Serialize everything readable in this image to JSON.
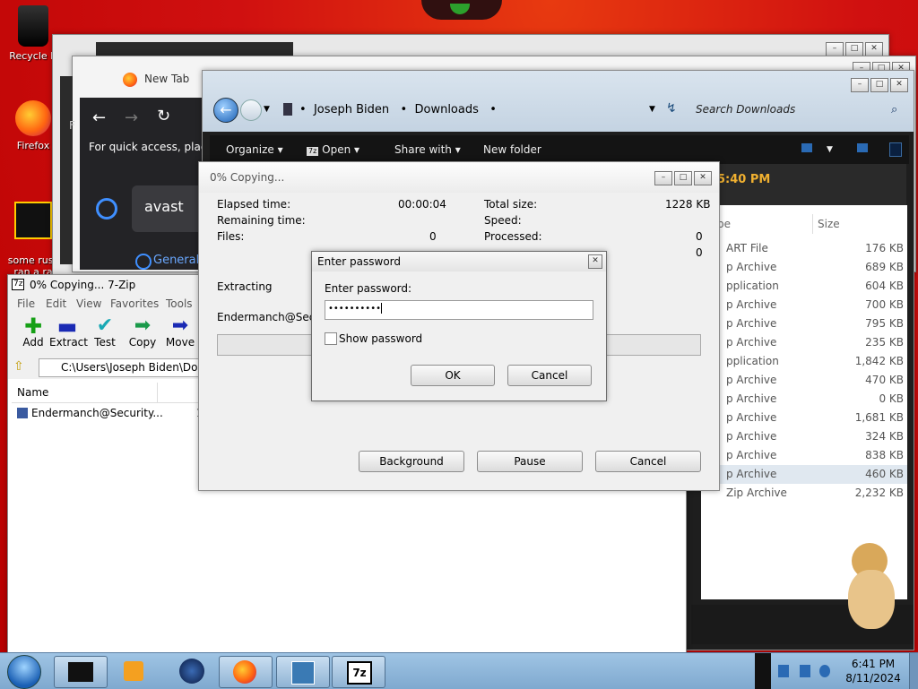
{
  "desktop": {
    "icons": [
      {
        "label": "Recycle Bin",
        "shown": "Recycle B"
      },
      {
        "label": "Firefox",
        "shown": "Firefox"
      },
      {
        "label": "some russ ran a ra",
        "shown": "some russ\nran a ra"
      }
    ]
  },
  "browser": {
    "tab_title": "New Tab",
    "quick_access_text": "For quick access, place y",
    "search_text": "avast",
    "general_tab": "General",
    "partial_letter": "F"
  },
  "explorer": {
    "breadcrumb": [
      "Joseph Biden",
      "Downloads"
    ],
    "search_placeholder": "Search Downloads",
    "toolbar": {
      "organize": "Organize",
      "open": "Open",
      "share_with": "Share with",
      "new_folder": "New folder"
    },
    "clock_text": "5:40 PM",
    "columns": {
      "type": "pe",
      "size": "Size"
    },
    "rows": [
      {
        "type": "ART File",
        "size": "176 KB"
      },
      {
        "type": "p Archive",
        "size": "689 KB"
      },
      {
        "type": "pplication",
        "size": "604 KB"
      },
      {
        "type": "p Archive",
        "size": "700 KB"
      },
      {
        "type": "p Archive",
        "size": "795 KB"
      },
      {
        "type": "p Archive",
        "size": "235 KB"
      },
      {
        "type": "pplication",
        "size": "1,842 KB"
      },
      {
        "type": "p Archive",
        "size": "470 KB"
      },
      {
        "type": "p Archive",
        "size": "0 KB"
      },
      {
        "type": "p Archive",
        "size": "1,681 KB"
      },
      {
        "type": "p Archive",
        "size": "324 KB"
      },
      {
        "type": "p Archive",
        "size": "838 KB"
      },
      {
        "type": "p Archive",
        "size": "460 KB"
      },
      {
        "type": "Zip Archive",
        "size": "2,232 KB"
      }
    ]
  },
  "sevenzip": {
    "title": "0% Copying... 7-Zip",
    "menu": [
      "File",
      "Edit",
      "View",
      "Favorites",
      "Tools"
    ],
    "toolbar": [
      "Add",
      "Extract",
      "Test",
      "Copy",
      "Move"
    ],
    "path": "C:\\Users\\Joseph Biden\\Down",
    "column_name": "Name",
    "file": "Endermanch@Security...",
    "file_suffix": "1"
  },
  "progress": {
    "title": "0% Copying...",
    "elapsed_label": "Elapsed time:",
    "elapsed_value": "00:00:04",
    "remaining_label": "Remaining time:",
    "files_label": "Files:",
    "files_value": "0",
    "total_label": "Total size:",
    "total_value": "1228 KB",
    "speed_label": "Speed:",
    "processed_label": "Processed:",
    "processed_value": "0",
    "extra_value": "0",
    "extracting": "Extracting",
    "current_file": "Endermanch@Security",
    "background_btn": "Background",
    "pause_btn": "Pause",
    "cancel_btn": "Cancel",
    "progress_fraction": 0
  },
  "password": {
    "title": "Enter password",
    "label": "Enter password:",
    "value": "••••••••••",
    "show_password": "Show password",
    "ok": "OK",
    "cancel": "Cancel"
  },
  "taskbar": {
    "time": "6:41 PM",
    "date": "8/11/2024"
  },
  "colors": {
    "desktop": "#c80000",
    "taskbar": "#8fb6da",
    "explorer_dark": "#1e1e1e",
    "browser_dark": "#232326"
  }
}
